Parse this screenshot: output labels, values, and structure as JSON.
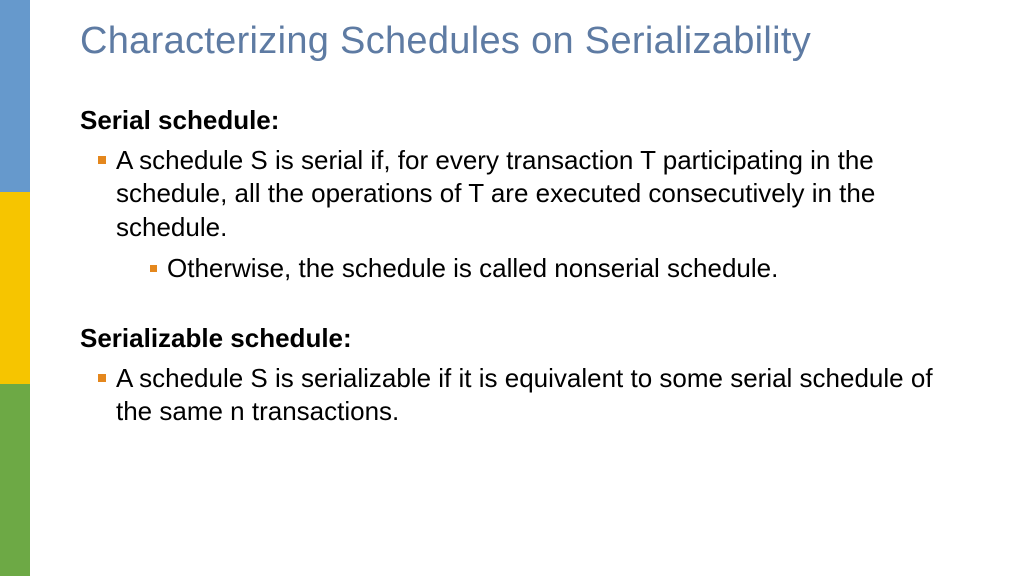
{
  "title": "Characterizing Schedules on Serializability",
  "sections": [
    {
      "heading": "Serial schedule:",
      "bullets": [
        {
          "level": 1,
          "text": "A schedule S is serial if, for every transaction T participating in the schedule, all the operations of T are executed consecutively in the schedule."
        },
        {
          "level": 2,
          "text": "Otherwise, the schedule is called nonserial schedule."
        }
      ]
    },
    {
      "heading": "Serializable schedule:",
      "bullets": [
        {
          "level": 1,
          "text": "A schedule S is serializable if it is equivalent to some serial schedule of the same n transactions."
        }
      ]
    }
  ],
  "accentColors": {
    "blue": "#6699cc",
    "yellow": "#f6c500",
    "green": "#6da945",
    "bullet": "#e4871d",
    "title": "#5e7ba3"
  }
}
